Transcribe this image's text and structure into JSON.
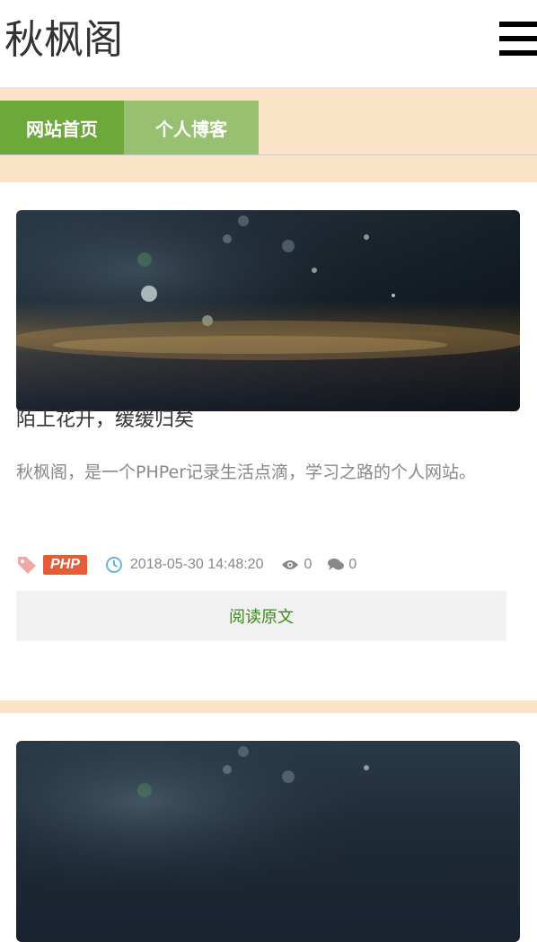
{
  "site": {
    "title": "秋枫阁"
  },
  "nav": {
    "items": [
      {
        "label": "网站首页"
      },
      {
        "label": "个人博客"
      }
    ]
  },
  "posts": [
    {
      "title": "陌上花开，缓缓归矣",
      "summary": "秋枫阁，是一个PHPer记录生活点滴，学习之路的个人网站。",
      "tag": "PHP",
      "datetime": "2018-05-30 14:48:20",
      "views": "0",
      "comments": "0",
      "read_label": "阅读原文"
    }
  ],
  "colors": {
    "nav_bg": "#fae3c6",
    "tab_active": "#6da83a",
    "tab_inactive": "#97c070",
    "badge": "#e45d39",
    "link_green": "#3b8a1a"
  },
  "icons": {
    "menu": "hamburger-icon",
    "tag": "tag-icon",
    "time": "clock-icon",
    "views": "eye-icon",
    "comments": "chat-icon"
  }
}
